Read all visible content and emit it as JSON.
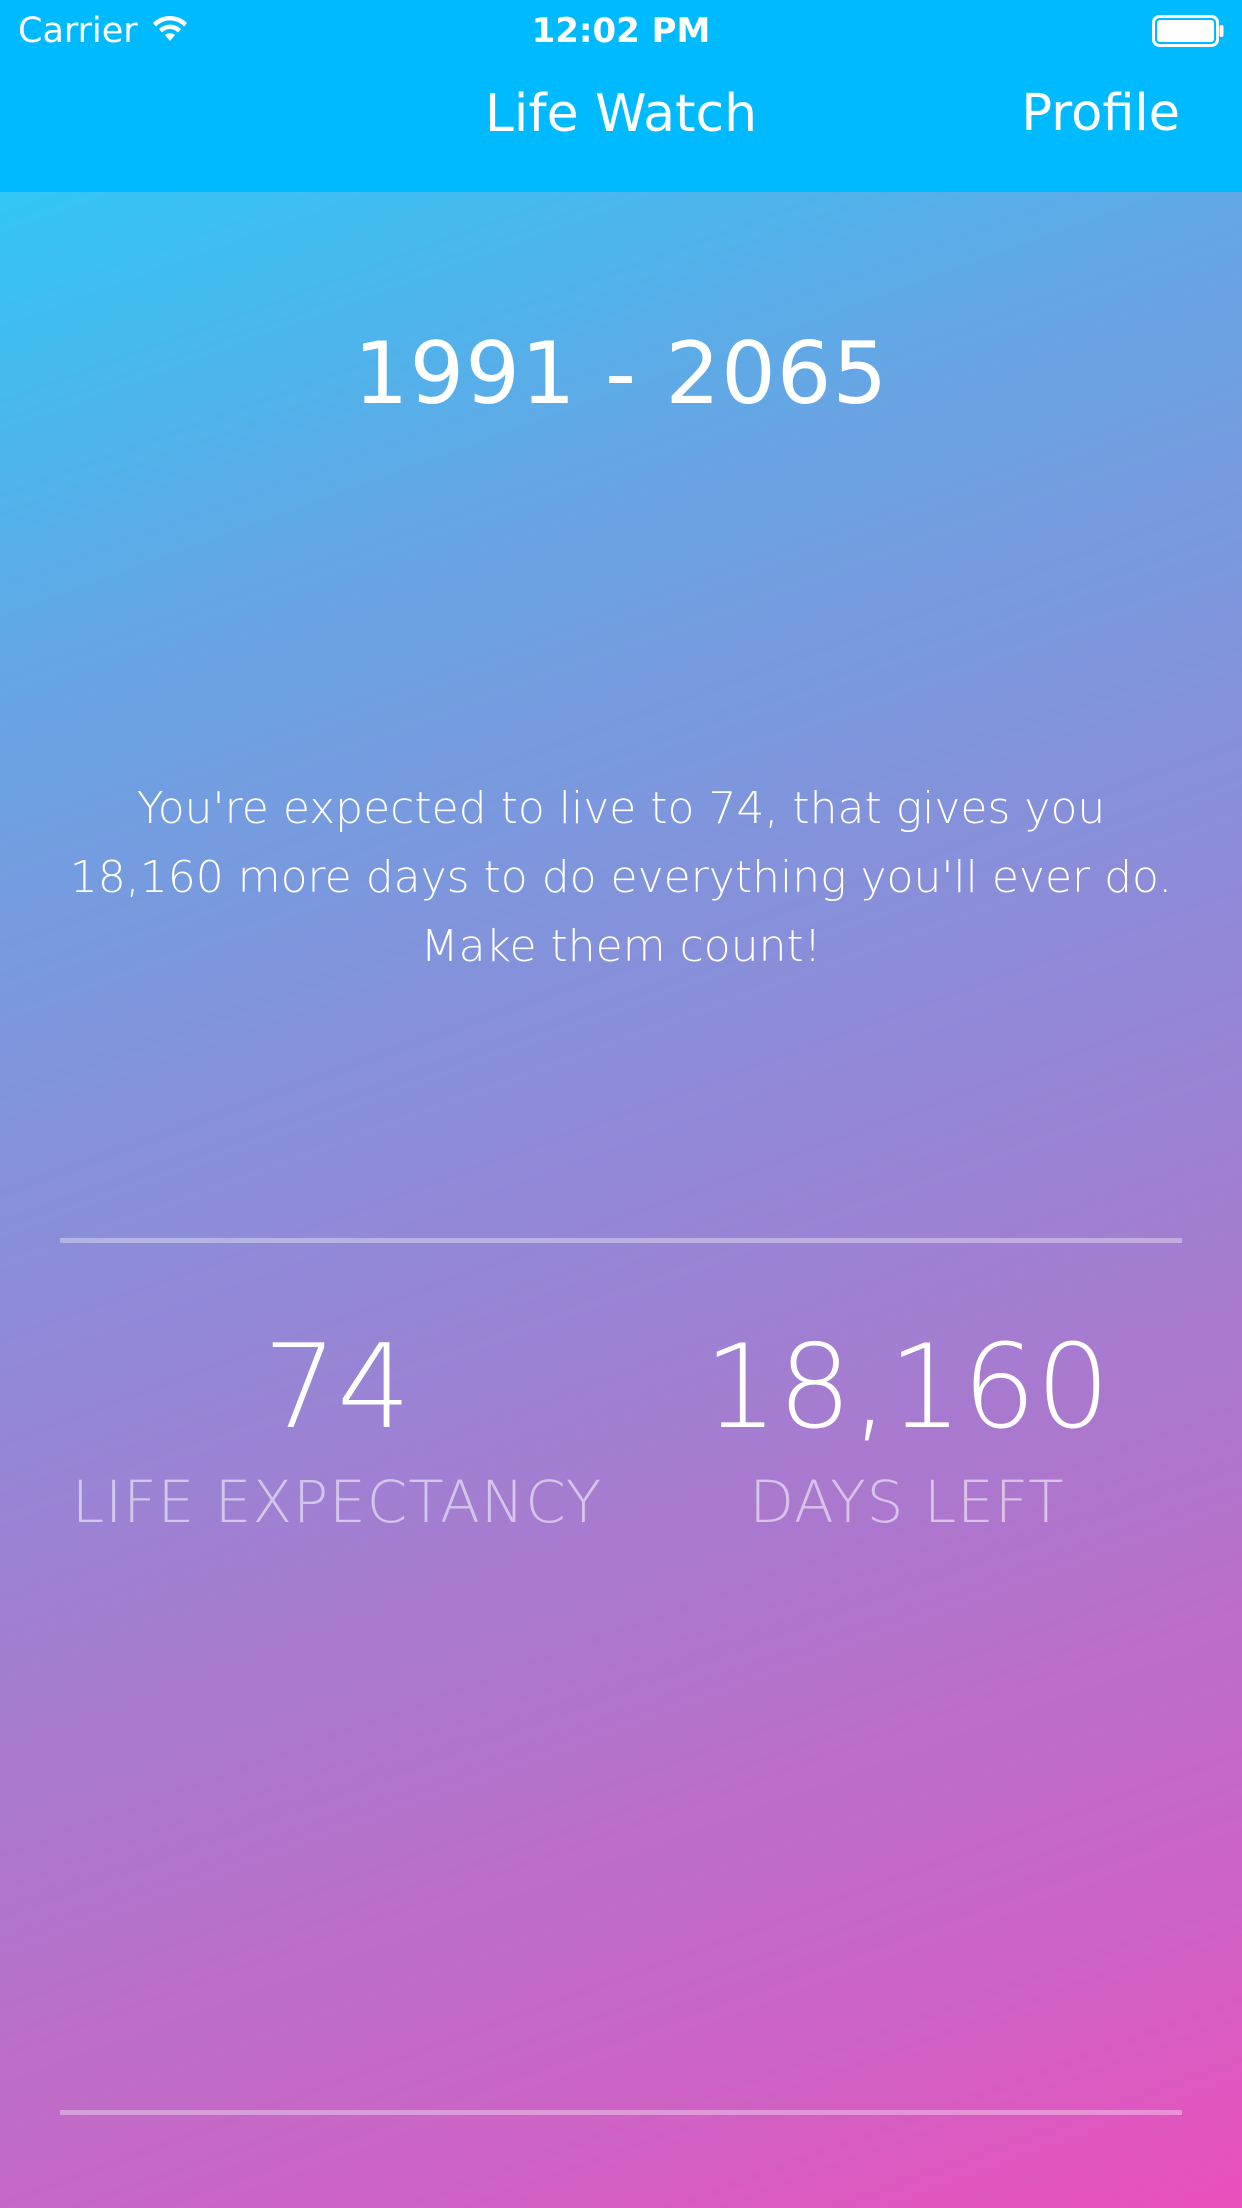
{
  "status_bar": {
    "carrier": "Carrier",
    "time": "12:02 PM",
    "wifi_icon": "wifi-icon",
    "battery_icon": "battery-full-icon"
  },
  "nav_bar": {
    "title": "Life Watch",
    "profile_label": "Profile"
  },
  "main": {
    "year_range": "1991 - 2065",
    "message_lines": [
      "You're expected to live to 74, that gives you",
      "18,160 more days to do everything you'll ever do.",
      "Make them count!"
    ],
    "stats": [
      {
        "value": "74",
        "label": "LIFE EXPECTANCY"
      },
      {
        "value": "18,160",
        "label": "DAYS LEFT"
      }
    ]
  },
  "colors": {
    "nav_background": "#00baff",
    "gradient_start": "#31c6f5",
    "gradient_end": "#ea4fbc",
    "text": "#ffffff"
  }
}
